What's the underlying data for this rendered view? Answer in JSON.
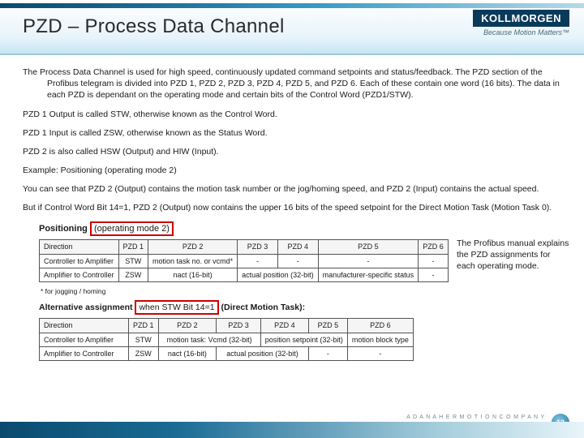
{
  "header": {
    "title": "PZD – Process Data Channel",
    "brand": "KOLLMORGEN",
    "tagline": "Because Motion Matters™"
  },
  "body": {
    "p1": "The Process Data Channel is used for high speed, continuously updated command setpoints and status/feedback.  The PZD section of the Profibus telegram is divided into PZD 1, PZD 2, PZD 3, PZD 4, PZD 5, and PZD 6.  Each of these contain one word (16 bits).  The data in each PZD is dependant on the operating mode and certain bits of the Control Word (PZD1/STW).",
    "p2": "PZD 1 Output is called STW, otherwise known as the Control Word.",
    "p3": "PZD 1 Input is called ZSW, otherwise known as the Status Word.",
    "p4": "PZD 2 is also called HSW (Output) and HIW (Input).",
    "p5": "Example: Positioning (operating mode 2)",
    "p6": "You can see that PZD 2 (Output) contains the motion task number or the jog/homing speed, and PZD 2 (Input) contains the actual speed.",
    "p7": "But if Control Word Bit 14=1, PZD 2 (Output) now contains the upper 16 bits of the speed setpoint for the Direct Motion Task (Motion Task 0)."
  },
  "fig": {
    "title_prefix": "Positioning",
    "title_box": "(operating mode 2)",
    "cols": {
      "dir": "Direction",
      "c1": "PZD 1",
      "c2": "PZD 2",
      "c3": "PZD 3",
      "c4": "PZD 4",
      "c5": "PZD 5",
      "c6": "PZD 6"
    },
    "t1": {
      "r1": {
        "dir": "Controller to Amplifier",
        "c1": "STW",
        "c2": "motion task no. or vcmd*",
        "c3": "-",
        "c4": "-",
        "c5": "-",
        "c6": "-"
      },
      "r2": {
        "dir": "Amplifier to Controller",
        "c1": "ZSW",
        "c2": "nact (16-bit)",
        "c34": "actual position (32-bit)",
        "c5": "manufacturer-specific status",
        "c6": "-"
      }
    },
    "foot": "* for jogging / homing",
    "alt_prefix": "Alternative assignment",
    "alt_box": "when STW Bit 14=1",
    "alt_suffix": "(Direct Motion Task):",
    "t2": {
      "r1": {
        "dir": "Controller to Amplifier",
        "c1": "STW",
        "c23": "motion task: Vcmd (32-bit)",
        "c45": "position setpoint (32-bit)",
        "c6": "motion block type"
      },
      "r2": {
        "dir": "Amplifier to Controller",
        "c1": "ZSW",
        "c2": "nact (16-bit)",
        "c34": "actual position (32-bit)",
        "c5": "-",
        "c6": "-"
      }
    },
    "side": "The Profibus manual explains the PZD assignments for each operating mode."
  },
  "footer": {
    "page": "12",
    "company": "A  D A N A H E R  M O T I O N  C O M P A N Y"
  }
}
